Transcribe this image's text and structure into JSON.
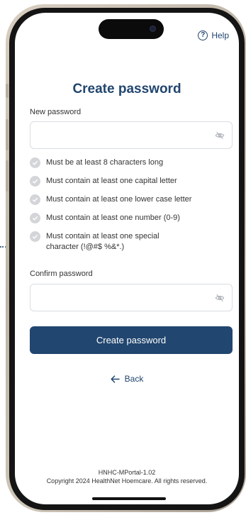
{
  "header": {
    "help_label": "Help",
    "help_icon": "question-circle-icon"
  },
  "page": {
    "title": "Create password"
  },
  "new_password": {
    "label": "New password",
    "value": "",
    "placeholder": "",
    "toggle_icon": "eye-off-icon"
  },
  "requirements": [
    {
      "text": "Must be at least 8 characters long",
      "met": false
    },
    {
      "text": "Must contain at least one capital letter",
      "met": false
    },
    {
      "text": "Must contain at least one lower case letter",
      "met": false
    },
    {
      "text": "Must contain at least one number (0-9)",
      "met": false
    },
    {
      "text": "Must contain at least one special character (!@#$ %&*.)",
      "met": false
    }
  ],
  "confirm_password": {
    "label": "Confirm password",
    "value": "",
    "placeholder": "",
    "toggle_icon": "eye-off-icon"
  },
  "actions": {
    "submit_label": "Create password",
    "back_label": "Back",
    "back_icon": "arrow-left-icon"
  },
  "footer": {
    "version": "HNHC-MPortal-1.02",
    "copyright": "Copyright 2024 HealthNet Hoemcare. All rights reserved."
  },
  "colors": {
    "brand": "#21466f",
    "check_inactive": "#d3d5d8",
    "field_border": "#d9dde2"
  }
}
